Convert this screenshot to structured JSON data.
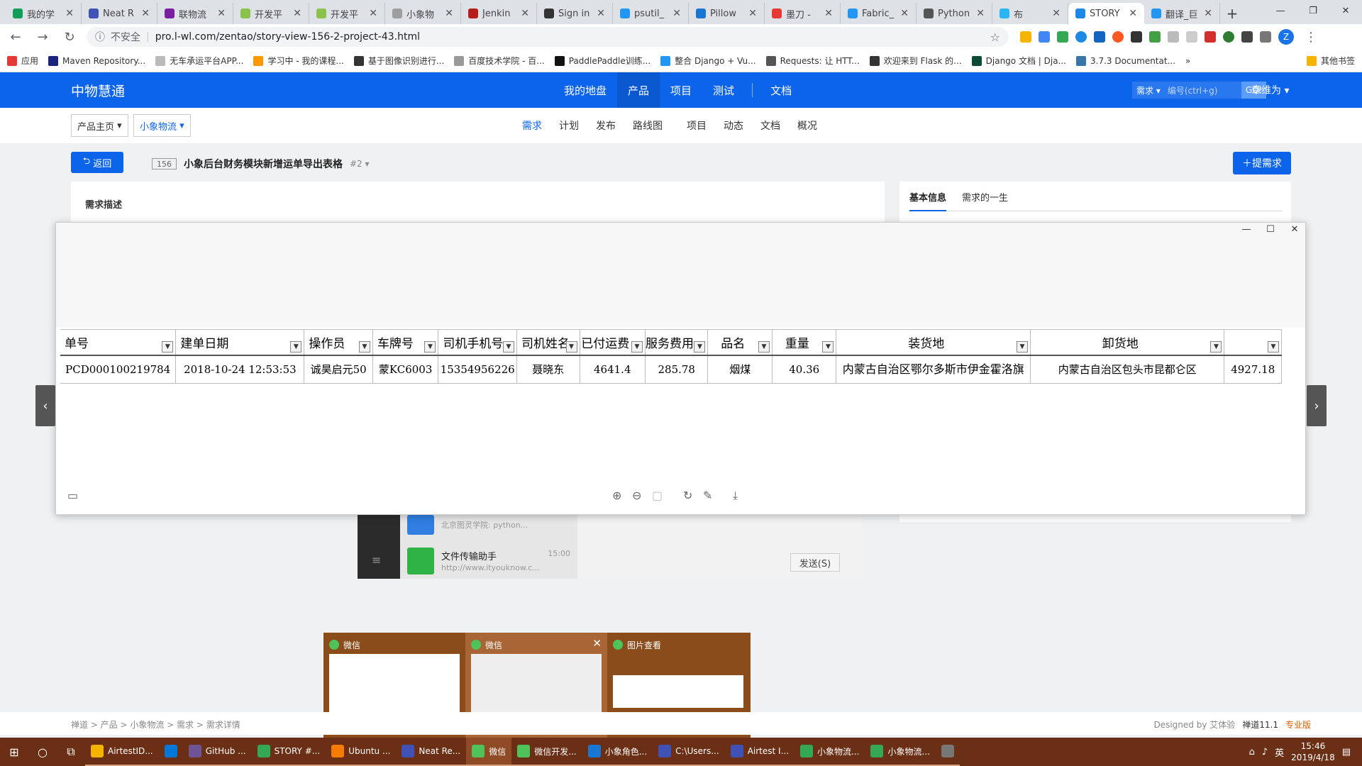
{
  "browser": {
    "tabs": [
      {
        "label": "我的学",
        "color": "#0f9d58"
      },
      {
        "label": "Neat R",
        "color": "#3f51b5"
      },
      {
        "label": "联物流",
        "color": "#7b1fa2"
      },
      {
        "label": "开发平",
        "color": "#8bc34a"
      },
      {
        "label": "开发平",
        "color": "#8bc34a"
      },
      {
        "label": "小象物",
        "color": "#9e9e9e"
      },
      {
        "label": "Jenkin",
        "color": "#b71c1c"
      },
      {
        "label": "Sign in",
        "color": "#333333"
      },
      {
        "label": "psutil_",
        "color": "#2196f3"
      },
      {
        "label": "Pillow",
        "color": "#1976d2"
      },
      {
        "label": "墨刀 - ",
        "color": "#e53935"
      },
      {
        "label": "Fabric_",
        "color": "#2196f3"
      },
      {
        "label": "Python",
        "color": "#555555"
      },
      {
        "label": "布",
        "color": "#29b6f6"
      },
      {
        "label": "STORY",
        "color": "#1e88e5",
        "active": true
      },
      {
        "label": "翻译_巨",
        "color": "#2196f3"
      }
    ],
    "url_insecure": "不安全",
    "url": "pro.l-wl.com/zentao/story-view-156-2-project-43.html",
    "bookmarks": [
      "应用",
      "Maven Repository...",
      "无车承运平台APP...",
      "学习中 - 我的课程...",
      "基于图像识别进行...",
      "百度技术学院 - 百...",
      "PaddlePaddle训练...",
      "整合 Django + Vu...",
      "Requests: 让 HTT...",
      "欢迎来到 Flask 的...",
      "Django 文档 | Dja...",
      "3.7.3 Documentat...",
      "»",
      "其他书签"
    ],
    "avatar_letter": "Z"
  },
  "zentao": {
    "brand": "中物慧通",
    "main_nav": [
      "我的地盘",
      "产品",
      "项目",
      "测试",
      "文档"
    ],
    "main_nav_active": "产品",
    "search_kind": "需求",
    "search_placeholder": "编号(ctrl+g)",
    "search_go": "GO!",
    "user": "章维为",
    "product_home": "产品主页",
    "product_name": "小象物流",
    "sub_nav": [
      "需求",
      "计划",
      "发布",
      "路线图",
      "项目",
      "动态",
      "文档",
      "概况"
    ],
    "sub_nav_active": "需求",
    "back_label": "返回",
    "story_id": "156",
    "story_title": "小象后台财务模块新增运单导出表格",
    "story_version": "#2",
    "create_label": "提需求",
    "desc_heading": "需求描述",
    "right_tabs": [
      "基本信息",
      "需求的一生"
    ],
    "footer_breadcrumb": "禅道 > 产品 > 小象物流 > 需求 > 需求详情",
    "footer_designed": "Designed by 艾体验",
    "footer_version": "禅道11.1",
    "footer_edition": "专业版"
  },
  "spreadsheet": {
    "headers": [
      "单号",
      "建单日期",
      "操作员",
      "车牌号",
      "司机手机号",
      "司机姓名",
      "已付运费",
      "服务费用",
      "品名",
      "重量",
      "装货地",
      "卸货地",
      ""
    ],
    "row": [
      "PCD000100219784",
      "2018-10-24 12:53:53",
      "诚昊启元50",
      "蒙KC6003",
      "15354956226",
      "聂晓东",
      "4641.4",
      "285.78",
      "烟煤",
      "40.36",
      "内蒙古自治区鄂尔多斯市伊金霍洛旗",
      "内蒙古自治区包头市昆都仑区",
      "4927.18"
    ]
  },
  "wechat": {
    "chat1_preview": "北京图灵学院: python...",
    "chat2_name": "文件传输助手",
    "chat2_time": "15:00",
    "chat2_preview": "http://www.ityouknow.c...",
    "send_label": "发送(S)"
  },
  "thumbnails": [
    {
      "title": "微信"
    },
    {
      "title": "微信"
    },
    {
      "title": "图片查看"
    }
  ],
  "taskbar": {
    "apps": [
      {
        "label": "AirtestID...",
        "color": "#f4b400"
      },
      {
        "label": "",
        "color": "#0078d7"
      },
      {
        "label": "GitHub ...",
        "color": "#6e5494"
      },
      {
        "label": "STORY #...",
        "color": "#34a853"
      },
      {
        "label": "Ubuntu ...",
        "color": "#f57c00"
      },
      {
        "label": "Neat Re...",
        "color": "#3f51b5"
      },
      {
        "label": "微信",
        "color": "#4fc35a",
        "active": true
      },
      {
        "label": "微信开发...",
        "color": "#4fc35a"
      },
      {
        "label": "小象角色...",
        "color": "#1976d2"
      },
      {
        "label": "C:\\Users...",
        "color": "#3f51b5"
      },
      {
        "label": "Airtest I...",
        "color": "#3f51b5"
      },
      {
        "label": "小象物流...",
        "color": "#34a853"
      },
      {
        "label": "小象物流...",
        "color": "#34a853"
      },
      {
        "label": "",
        "color": "#777777"
      }
    ],
    "ime": "英",
    "time": "15:46",
    "date": "2019/4/18"
  }
}
